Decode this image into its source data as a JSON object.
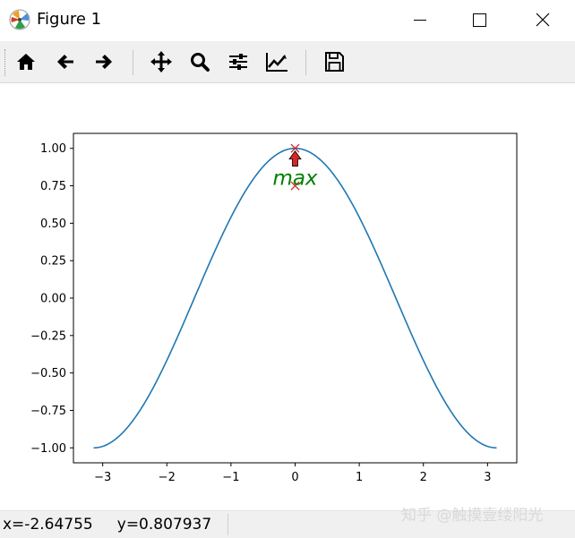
{
  "window": {
    "title": "Figure 1"
  },
  "window_controls": [
    {
      "name": "minimize-icon"
    },
    {
      "name": "maximize-icon"
    },
    {
      "name": "close-icon"
    }
  ],
  "toolbar": {
    "buttons": [
      {
        "name": "home-icon",
        "tooltip": "Home"
      },
      {
        "name": "back-arrow-icon",
        "tooltip": "Back"
      },
      {
        "name": "forward-arrow-icon",
        "tooltip": "Forward"
      },
      {
        "name": "pan-icon",
        "tooltip": "Pan"
      },
      {
        "name": "zoom-icon",
        "tooltip": "Zoom"
      },
      {
        "name": "configure-subplots-icon",
        "tooltip": "Subplots"
      },
      {
        "name": "edit-axes-icon",
        "tooltip": "Customize"
      },
      {
        "name": "save-icon",
        "tooltip": "Save"
      }
    ]
  },
  "status": {
    "coords": "x=-2.64755     y=0.807937"
  },
  "watermark": "知乎 @触摸壹缕阳光",
  "colors": {
    "line": "#1f77b4",
    "marker": "#d62728",
    "annotation_text": "#008000",
    "arrow": "#d62728"
  },
  "chart_data": {
    "type": "line",
    "x_range": [
      -3.14159,
      3.14159
    ],
    "function": "cos(x)",
    "xlim": [
      -3.456,
      3.456
    ],
    "ylim": [
      -1.1,
      1.1
    ],
    "xticks": [
      -3,
      -2,
      -1,
      0,
      1,
      2,
      3
    ],
    "yticks": [
      -1.0,
      -0.75,
      -0.5,
      -0.25,
      0.0,
      0.25,
      0.5,
      0.75,
      1.0
    ],
    "ytick_labels": [
      "−1.00",
      "−0.75",
      "−0.50",
      "−0.25",
      "0.00",
      "0.25",
      "0.50",
      "0.75",
      "1.00"
    ],
    "xtick_labels": [
      "−3",
      "−2",
      "−1",
      "0",
      "1",
      "2",
      "3"
    ],
    "markers": [
      {
        "x": 0,
        "y": 1.0,
        "symbol": "x"
      },
      {
        "x": 0,
        "y": 0.75,
        "symbol": "x"
      }
    ],
    "annotation": {
      "text": "max",
      "xy": [
        0,
        1.0
      ],
      "xytext": [
        0,
        0.75
      ]
    }
  }
}
